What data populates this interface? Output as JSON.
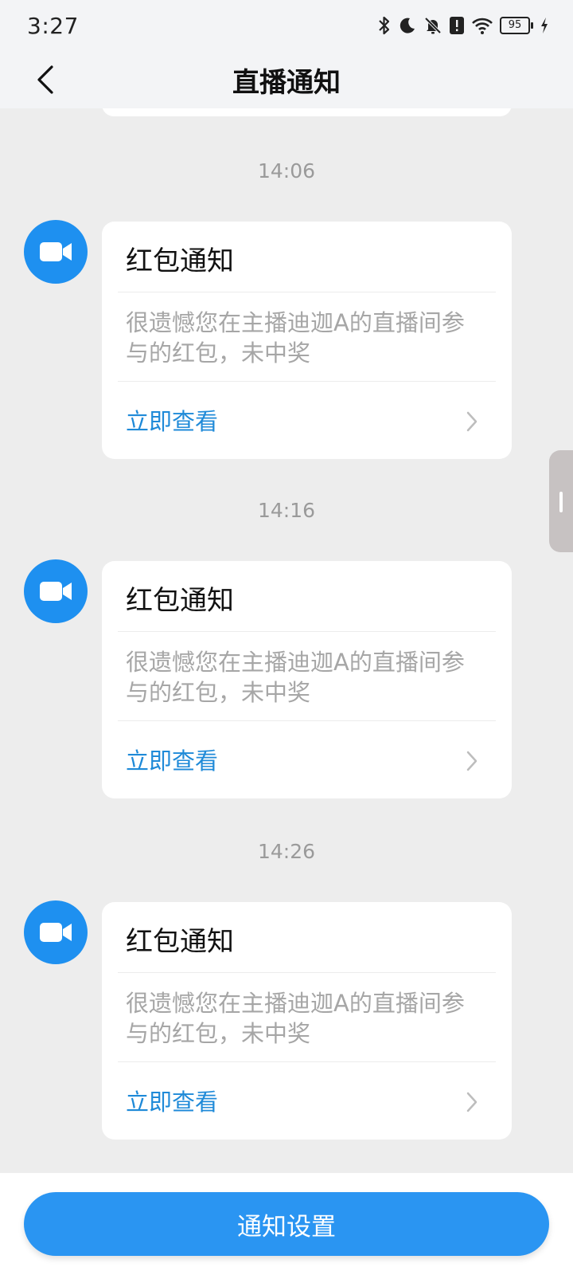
{
  "status_bar": {
    "time": "3:27",
    "icons": [
      "bluetooth-icon",
      "moon-icon",
      "bell-off-icon",
      "alert-icon",
      "wifi-icon"
    ],
    "battery_level": "95"
  },
  "nav": {
    "title": "直播通知",
    "back_icon": "chevron-left-icon"
  },
  "notifications": [
    {
      "time": "14:06",
      "title": "红包通知",
      "body": "很遗憾您在主播迪迦A的直播间参与的红包，未中奖",
      "action": "立即查看"
    },
    {
      "time": "14:16",
      "title": "红包通知",
      "body": "很遗憾您在主播迪迦A的直播间参与的红包，未中奖",
      "action": "立即查看"
    },
    {
      "time": "14:26",
      "title": "红包通知",
      "body": "很遗憾您在主播迪迦A的直播间参与的红包，未中奖",
      "action": "立即查看"
    }
  ],
  "footer": {
    "settings_label": "通知设置"
  },
  "colors": {
    "accent": "#2a95f2",
    "avatar": "#1e90f0",
    "link": "#1f8ad8",
    "background": "#ededed"
  }
}
